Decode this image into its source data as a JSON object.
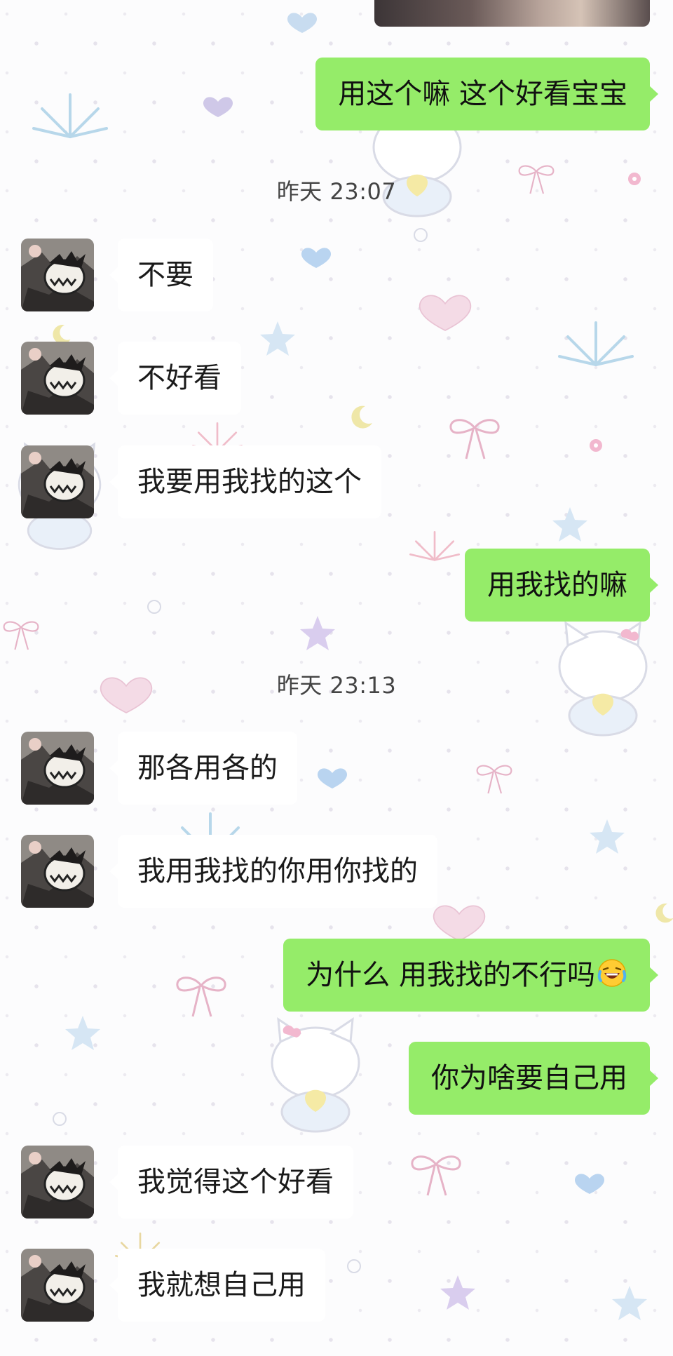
{
  "chat": {
    "timestamps": {
      "t1": "昨天 23:07",
      "t2": "昨天 23:13"
    },
    "messages": [
      {
        "side": "right",
        "text": "用这个嘛 这个好看宝宝"
      },
      {
        "side": "left",
        "text": "不要"
      },
      {
        "side": "left",
        "text": "不好看"
      },
      {
        "side": "left",
        "text": "我要用我找的这个"
      },
      {
        "side": "right",
        "text": "用我找的嘛"
      },
      {
        "side": "left",
        "text": "那各用各的"
      },
      {
        "side": "left",
        "text": "我用我找的你用你找的"
      },
      {
        "side": "right",
        "text": "为什么 用我找的不行吗",
        "emoji": "laughing-crying-emoji"
      },
      {
        "side": "right",
        "text": "你为啥要自己用"
      },
      {
        "side": "left",
        "text": "我觉得这个好看"
      },
      {
        "side": "left",
        "text": "我就想自己用"
      }
    ]
  },
  "colors": {
    "sent_bubble": "#95ec69",
    "received_bubble": "#ffffff",
    "background": "#fcfcfd"
  },
  "icons": {
    "avatar": "cartoon-avatar-icon",
    "emoji": "laughing-crying-emoji"
  }
}
